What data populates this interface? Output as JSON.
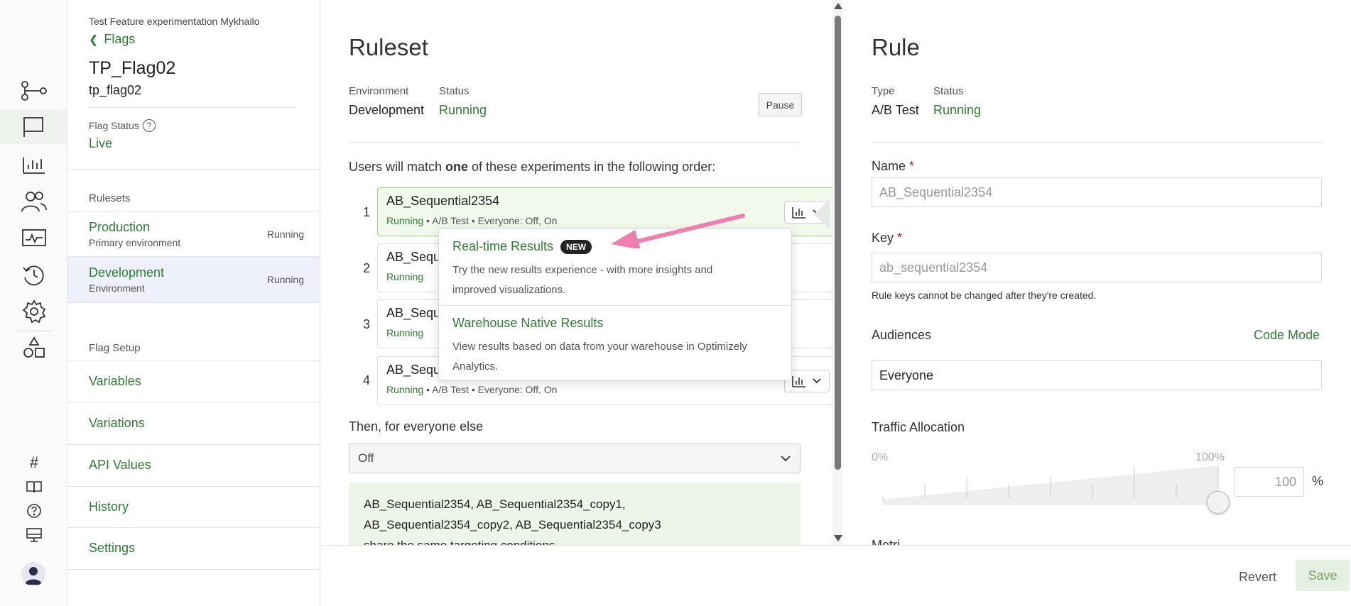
{
  "rail": {
    "icons": [
      "flow-icon",
      "flag-icon",
      "bar-chart-icon",
      "users-icon",
      "monitor-chart-icon",
      "history-icon",
      "gear-icon",
      "shapes-icon"
    ],
    "bottom_icons": [
      "hash-icon",
      "book-icon",
      "help-icon",
      "desktop-icon",
      "user-avatar-icon"
    ],
    "hash_glyph": "#"
  },
  "sidebar": {
    "project": "Test Feature experimentation Mykhailo",
    "back_label": "Flags",
    "flag_name": "TP_Flag02",
    "flag_key": "tp_flag02",
    "flag_status_label": "Flag Status",
    "flag_status": "Live",
    "rulesets_heading": "Rulesets",
    "rulesets": [
      {
        "name": "Production",
        "sub": "Primary environment",
        "status": "Running"
      },
      {
        "name": "Development",
        "sub": "Environment",
        "status": "Running"
      }
    ],
    "setup_heading": "Flag Setup",
    "setup_items": [
      "Variables",
      "Variations",
      "API Values",
      "History",
      "Settings"
    ]
  },
  "ruleset": {
    "title": "Ruleset",
    "env_label": "Environment",
    "env_value": "Development",
    "status_label": "Status",
    "status_value": "Running",
    "pause_label": "Pause",
    "order_prefix": "Users will match ",
    "order_bold": "one",
    "order_suffix": " of these experiments in the following order:",
    "experiments": [
      {
        "num": "1",
        "title": "AB_Sequential2354",
        "status": "Running",
        "meta": " • A/B Test • Everyone: Off, On"
      },
      {
        "num": "2",
        "title": "AB_Sequ",
        "status": "Running",
        "meta": ""
      },
      {
        "num": "3",
        "title": "AB_Sequ",
        "status": "Running",
        "meta": ""
      },
      {
        "num": "4",
        "title": "AB_Sequ",
        "status": "Running",
        "meta": " • A/B Test • Everyone: Off, On"
      }
    ],
    "else_label": "Then, for everyone else",
    "else_value": "Off",
    "note_line1": "AB_Sequential2354, AB_Sequential2354_copy1,",
    "note_line2": "AB_Sequential2354_copy2, AB_Sequential2354_copy3",
    "note_line3": "share the same targeting conditions."
  },
  "popover": {
    "items": [
      {
        "title": "Real-time Results",
        "badge": "NEW",
        "desc_line1": "Try the new results experience - with more insights and",
        "desc_line2": "improved visualizations."
      },
      {
        "title": "Warehouse Native Results",
        "badge": "",
        "desc_line1": "View results based on data from your warehouse in Optimizely",
        "desc_line2": "Analytics."
      }
    ]
  },
  "rule": {
    "title": "Rule",
    "type_label": "Type",
    "type_value": "A/B Test",
    "status_label": "Status",
    "status_value": "Running",
    "name_label": "Name",
    "required_mark": "*",
    "name_value": "AB_Sequential2354",
    "key_label": "Key",
    "key_value": "ab_sequential2354",
    "key_help": "Rule keys cannot be changed after they're created.",
    "audiences_label": "Audiences",
    "code_mode_label": "Code Mode",
    "audience_value": "Everyone",
    "traffic_label": "Traffic Allocation",
    "traffic_min": "0%",
    "traffic_max": "100%",
    "traffic_value": "100",
    "traffic_unit": "%",
    "traffic_fraction": 1.0,
    "cut_label": "Metri"
  },
  "footer": {
    "revert_label": "Revert",
    "save_label": "Save"
  },
  "colors": {
    "accent": "#2e7d32",
    "arrow": "#f07fb0",
    "selected_row": "#eef1fb"
  }
}
